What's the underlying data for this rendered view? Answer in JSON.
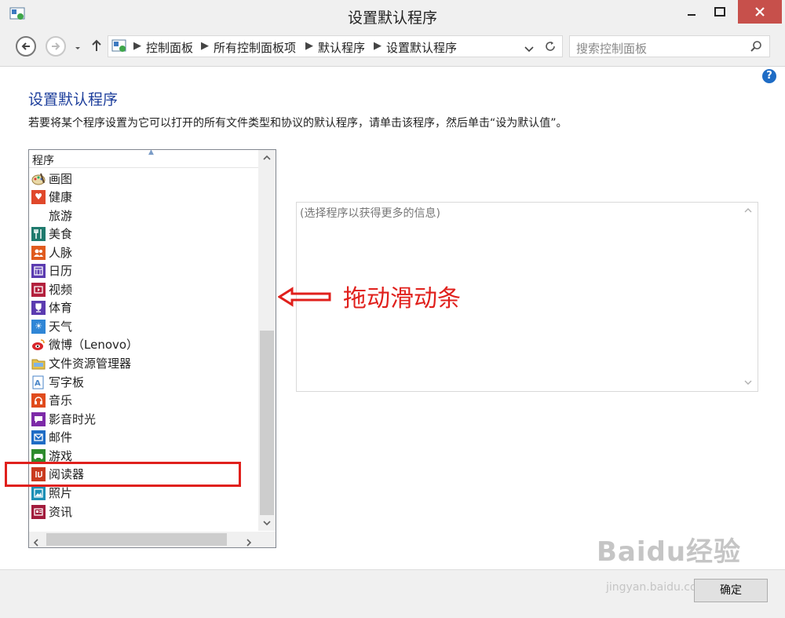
{
  "window": {
    "title": "设置默认程序"
  },
  "breadcrumbs": [
    "控制面板",
    "所有控制面板项",
    "默认程序",
    "设置默认程序"
  ],
  "search": {
    "placeholder": "搜索控制面板"
  },
  "content": {
    "heading": "设置默认程序",
    "description": "若要将某个程序设置为它可以打开的所有文件类型和协议的默认程序，请单击该程序，然后单击“设为默认值”。"
  },
  "program_list": {
    "header": "程序",
    "items": [
      {
        "label": "画图",
        "icon": "paint-icon"
      },
      {
        "label": "健康",
        "icon": "health-icon",
        "color": "#e0482b"
      },
      {
        "label": "旅游",
        "icon": "none"
      },
      {
        "label": "美食",
        "icon": "food-icon",
        "color": "#1f7a6d"
      },
      {
        "label": "人脉",
        "icon": "people-icon",
        "color": "#e05b1e"
      },
      {
        "label": "日历",
        "icon": "calendar-icon",
        "color": "#5b3bb0"
      },
      {
        "label": "视频",
        "icon": "video-icon",
        "color": "#b3203d"
      },
      {
        "label": "体育",
        "icon": "sports-icon",
        "color": "#5b3bb0"
      },
      {
        "label": "天气",
        "icon": "weather-icon",
        "color": "#2f86d6"
      },
      {
        "label": "微博（Lenovo）",
        "icon": "weibo-icon",
        "color": "#d9262b"
      },
      {
        "label": "文件资源管理器",
        "icon": "folder-icon",
        "color": "#e6c24a"
      },
      {
        "label": "写字板",
        "icon": "wordpad-icon",
        "color": "#4a86c8"
      },
      {
        "label": "音乐",
        "icon": "music-icon",
        "color": "#e04b1c"
      },
      {
        "label": "影音时光",
        "icon": "media-icon",
        "color": "#7d2aa8"
      },
      {
        "label": "邮件",
        "icon": "mail-icon",
        "color": "#1e6cc5"
      },
      {
        "label": "游戏",
        "icon": "games-icon",
        "color": "#2e8b2e"
      },
      {
        "label": "阅读器",
        "icon": "reader-icon",
        "color": "#c93a1f"
      },
      {
        "label": "照片",
        "icon": "photos-icon",
        "color": "#1b8fb5"
      },
      {
        "label": "资讯",
        "icon": "news-icon",
        "color": "#a21c3d"
      }
    ]
  },
  "info_panel": {
    "text": "(选择程序以获得更多的信息)"
  },
  "annotation": {
    "text": "拖动滑动条"
  },
  "buttons": {
    "ok": "确定"
  },
  "watermark": {
    "main": "Baidu经验",
    "sub": "jingyan.baidu.com"
  },
  "colors": {
    "accent": "#1e3f9c",
    "annotation": "#e0201c"
  }
}
